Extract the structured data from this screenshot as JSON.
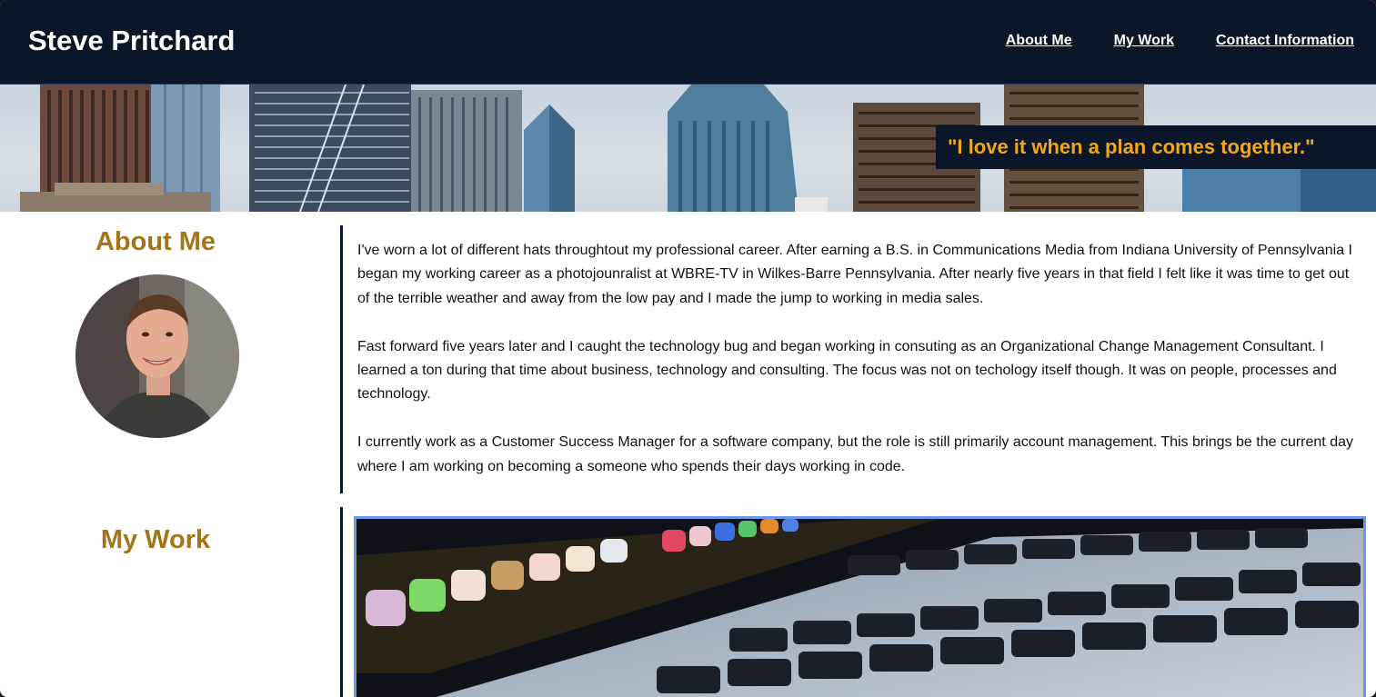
{
  "header": {
    "title": "Steve Pritchard",
    "nav": [
      {
        "label": "About Me"
      },
      {
        "label": "My Work"
      },
      {
        "label": "Contact Information"
      }
    ]
  },
  "hero": {
    "quote": "\"I love it when a plan comes together.\""
  },
  "about": {
    "heading": "About Me",
    "paragraphs": [
      "I've worn a lot of different hats throughtout my professional career. After earning a B.S. in Communications Media from Indiana University of Pennsylvania I began my working career as a photojounralist at WBRE-TV in Wilkes-Barre Pennsylvania. After nearly five years in that field I felt like it was time to get out of the terrible weather and away from the low pay and I made the jump to working in media sales.",
      "Fast forward five years later and I caught the technology bug and began working in consuting as an Organizational Change Management Consultant. I learned a ton during that time about business, technology and consulting. The focus was not on techology itself though. It was on people, processes and technology.",
      "I currently work as a Customer Success Manager for a software company, but the role is still primarily account management. This brings be the current day where I am working on becoming a someone who spends their days working in code."
    ]
  },
  "work": {
    "heading": "My Work"
  },
  "colors": {
    "header_bg": "#0b1628",
    "accent_gold": "#a3741a",
    "quote_orange": "#f2a81d",
    "image_border": "#6b98ea"
  },
  "icons": {
    "avatar": "profile-photo",
    "hero": "city-skyline-image",
    "work": "laptop-keyboard-image"
  }
}
